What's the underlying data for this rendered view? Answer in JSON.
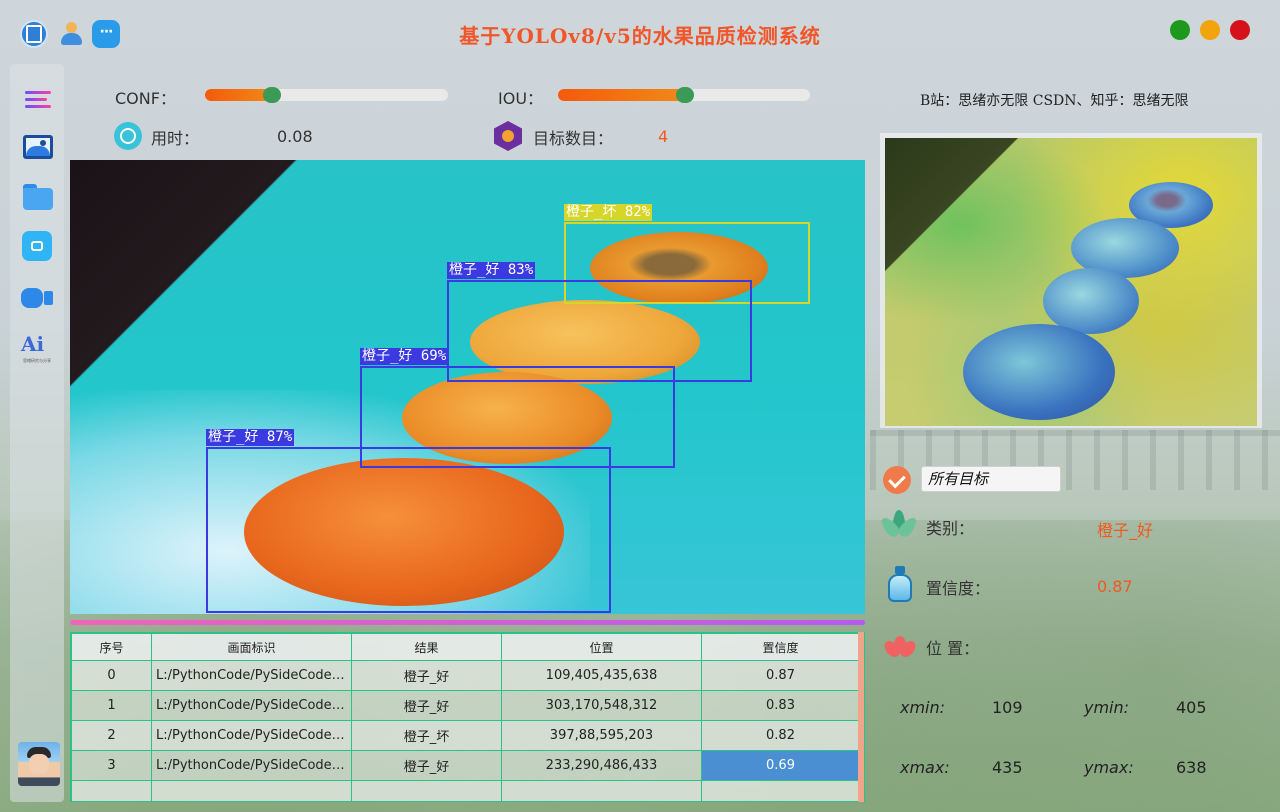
{
  "app": {
    "title": "基于YOLOv8/v5的水果品质检测系统",
    "credit": "B站：思绪亦无限  CSDN、知乎：思绪无限",
    "window_controls": {
      "green": "#1d9a1d",
      "orange": "#f3a30c",
      "red": "#d5111a"
    }
  },
  "topbar_icons": [
    "app-icon",
    "user-icon",
    "chat-icon"
  ],
  "sidebar": {
    "items": [
      "menu-icon",
      "image-icon",
      "folder-icon",
      "camera-icon",
      "video-icon",
      "logo-icon"
    ],
    "logo_text": "Ai",
    "logo_sub": "思绪研究与分享"
  },
  "controls": {
    "conf_label": "CONF：",
    "conf_value": 0.25,
    "iou_label": "IOU：",
    "iou_value": 0.5,
    "time_label": "用时：",
    "time_value": "0.08",
    "count_label": "目标数目：",
    "count_value": "4"
  },
  "detections_overlay": [
    {
      "label": "橙子_坏 82%",
      "color": "#d6d62a"
    },
    {
      "label": "橙子_好 83%",
      "color": "#3a3ae0"
    },
    {
      "label": "橙子_好 69%",
      "color": "#3a3ae0"
    },
    {
      "label": "橙子_好 87%",
      "color": "#3a3ae0"
    }
  ],
  "table": {
    "headers": [
      "序号",
      "画面标识",
      "结果",
      "位置",
      "置信度"
    ],
    "rows": [
      {
        "index": "0",
        "source": "L:/PythonCode/PySideCode/...",
        "result": "橙子_好",
        "position": "109,405,435,638",
        "confidence": "0.87"
      },
      {
        "index": "1",
        "source": "L:/PythonCode/PySideCode/...",
        "result": "橙子_好",
        "position": "303,170,548,312",
        "confidence": "0.83"
      },
      {
        "index": "2",
        "source": "L:/PythonCode/PySideCode/...",
        "result": "橙子_坏",
        "position": "397,88,595,203",
        "confidence": "0.82"
      },
      {
        "index": "3",
        "source": "L:/PythonCode/PySideCode/...",
        "result": "橙子_好",
        "position": "233,290,486,433",
        "confidence": "0.69"
      }
    ]
  },
  "details": {
    "target_select": "所有目标",
    "class_label": "类别：",
    "class_value": "橙子_好",
    "conf_label": "置信度：",
    "conf_value": "0.87",
    "pos_label": "位 置：",
    "xmin_label": "xmin:",
    "xmin_value": "109",
    "ymin_label": "ymin:",
    "ymin_value": "405",
    "xmax_label": "xmax:",
    "xmax_value": "435",
    "ymax_label": "ymax:",
    "ymax_value": "638"
  }
}
